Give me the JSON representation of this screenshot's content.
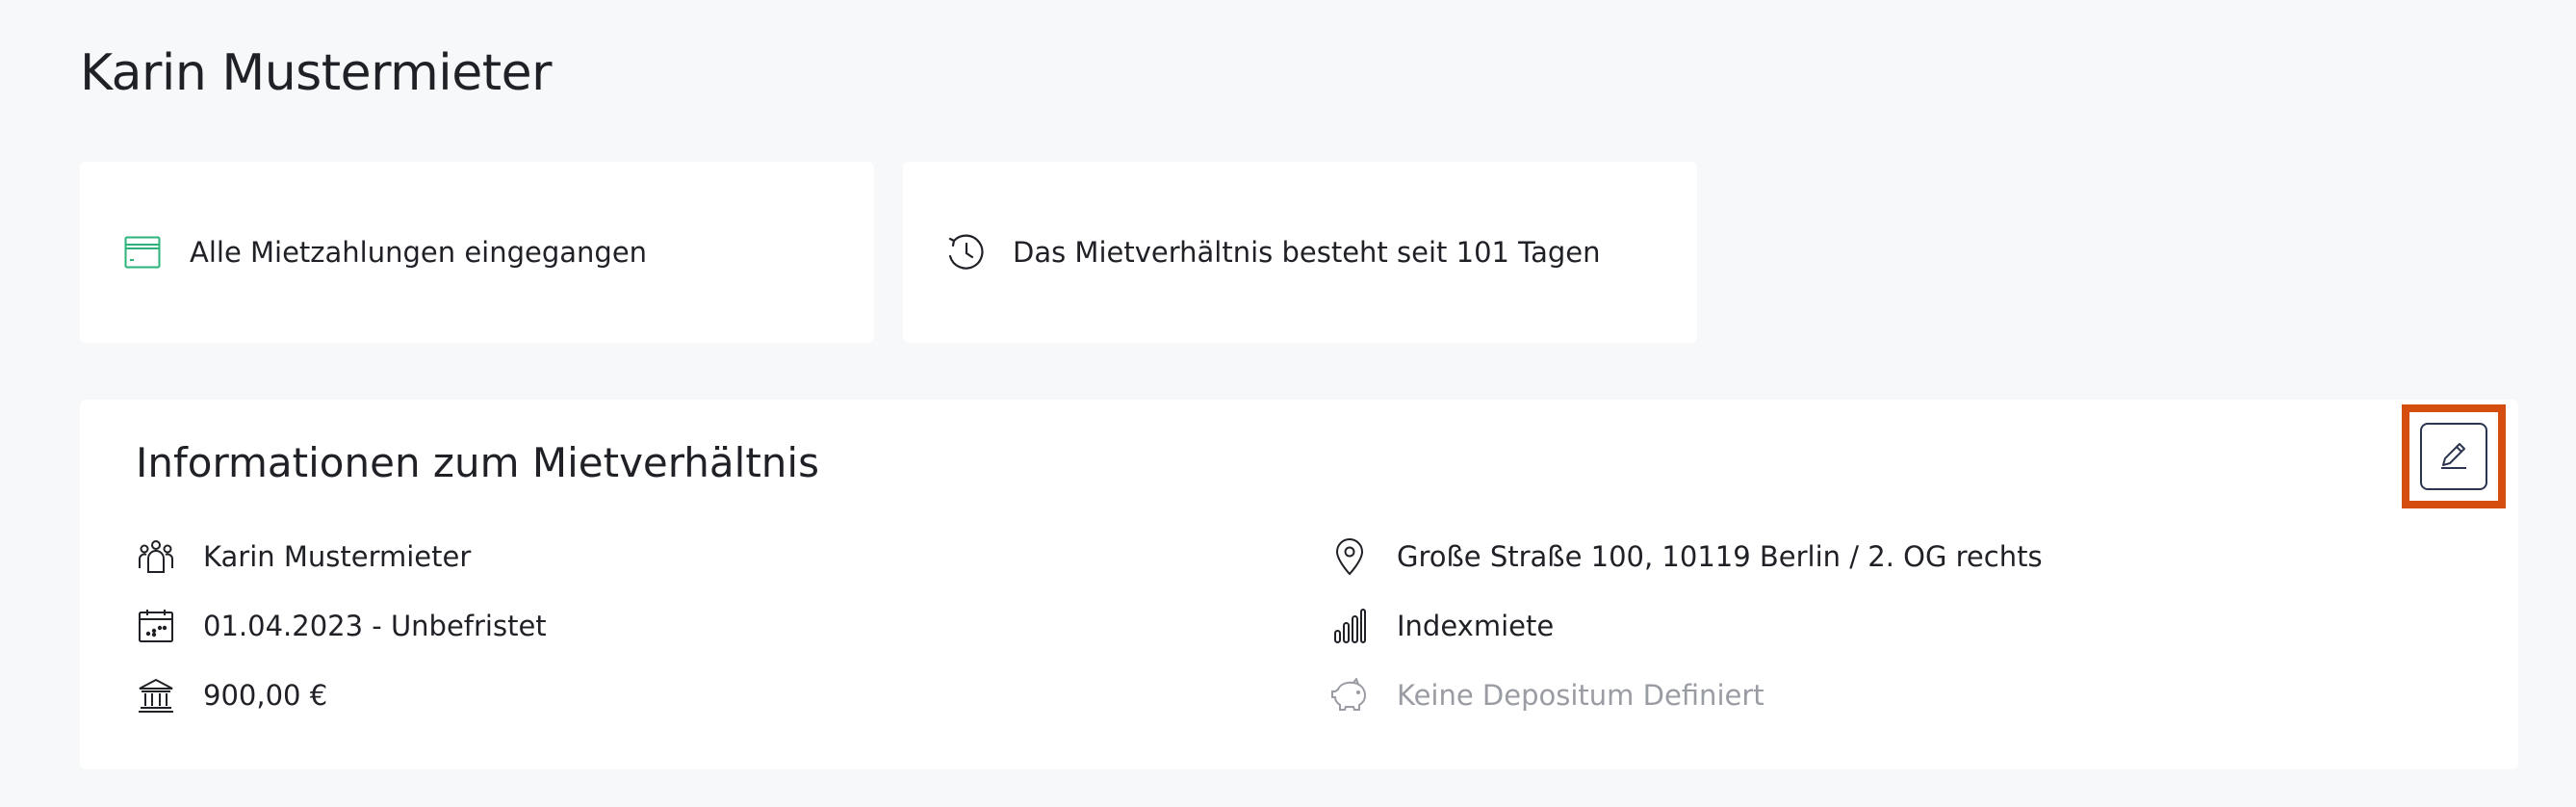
{
  "page": {
    "title": "Karin Mustermieter"
  },
  "status_cards": {
    "payments": {
      "icon": "credit-card-icon",
      "label": "Alle Mietzahlungen eingegangen"
    },
    "duration": {
      "icon": "history-clock-icon",
      "label": "Das Mietverhältnis besteht seit 101 Tagen"
    }
  },
  "info": {
    "title": "Informationen zum Mietverhältnis",
    "edit_icon": "pencil-icon",
    "left": [
      {
        "icon": "tenants-icon",
        "text": "Karin Mustermieter"
      },
      {
        "icon": "calendar-icon",
        "text": "01.04.2023 - Unbefristet"
      },
      {
        "icon": "bank-icon",
        "text": "900,00 €"
      }
    ],
    "right": [
      {
        "icon": "location-pin-icon",
        "text": "Große Straße 100, 10119 Berlin / 2. OG rechts"
      },
      {
        "icon": "bar-chart-icon",
        "text": "Indexmiete"
      },
      {
        "icon": "piggy-bank-icon",
        "text": "Keine Depositum Definiert"
      }
    ]
  },
  "colors": {
    "background": "#f7f8fa",
    "card": "#ffffff",
    "text": "#1f2126",
    "muted_text": "#9a9ca3",
    "accent_green": "#2bb37a",
    "highlight": "#d64d10",
    "button_border": "#2c3550"
  }
}
